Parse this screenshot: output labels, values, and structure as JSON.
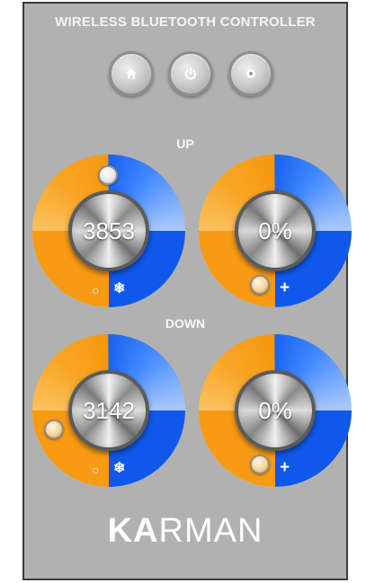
{
  "title": "WIRELESS BLUETOOTH CONTROLLER",
  "top_buttons": [
    {
      "icon": "home-icon"
    },
    {
      "icon": "power-icon"
    },
    {
      "icon": "settings-icon"
    }
  ],
  "sections": {
    "up": {
      "label": "UP",
      "cct": {
        "value": "3853",
        "symbols": {
          "warm": "○",
          "cool": "❄"
        }
      },
      "brightness": {
        "value": "0%",
        "symbols": {
          "plus": "+"
        }
      }
    },
    "down": {
      "label": "DOWN",
      "cct": {
        "value": "3142",
        "symbols": {
          "warm": "○",
          "cool": "❄"
        }
      },
      "brightness": {
        "value": "0%",
        "symbols": {
          "plus": "+"
        }
      }
    }
  },
  "brand": {
    "heavy": "KA",
    "light": "RMAN"
  },
  "colors": {
    "panel": "#b1b1b1",
    "warm": "#f79a14",
    "cool": "#0f58ea",
    "text": "#ffffff"
  }
}
